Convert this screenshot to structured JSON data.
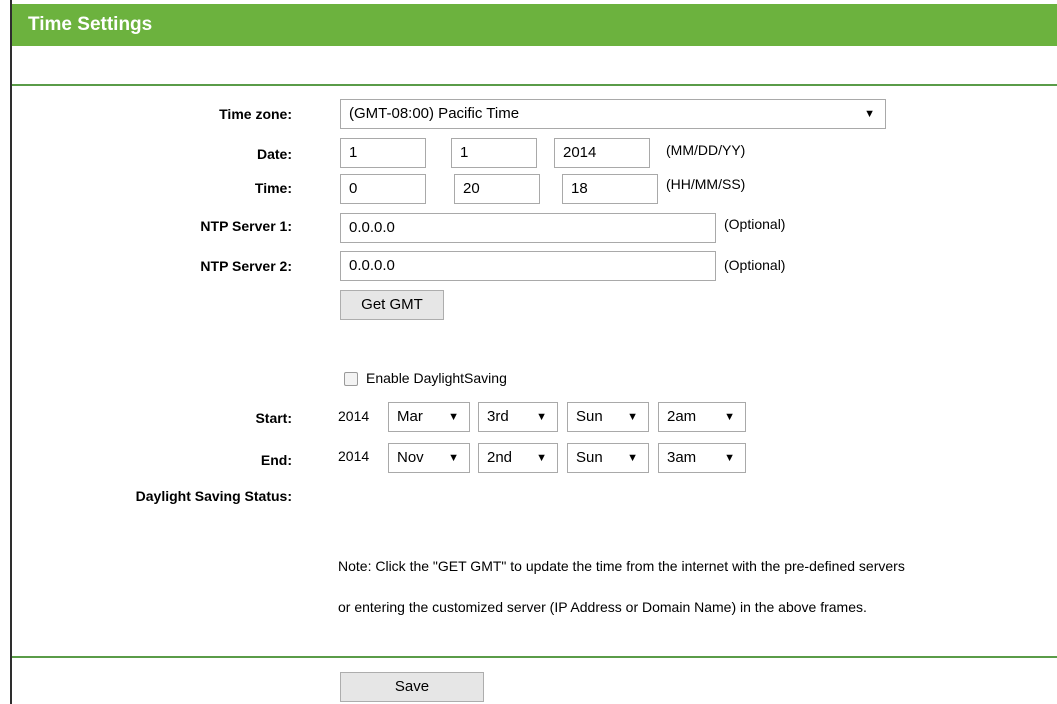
{
  "header": {
    "title": "Time Settings"
  },
  "form": {
    "time_zone": {
      "label": "Time zone:",
      "value": "(GMT-08:00) Pacific Time"
    },
    "date": {
      "label": "Date:",
      "month": "1",
      "day": "1",
      "year": "2014",
      "hint": "(MM/DD/YY)"
    },
    "time": {
      "label": "Time:",
      "hour": "0",
      "minute": "20",
      "second": "18",
      "hint": "(HH/MM/SS)"
    },
    "ntp1": {
      "label": "NTP Server 1:",
      "value": "0.0.0.0",
      "hint": "(Optional)"
    },
    "ntp2": {
      "label": "NTP Server 2:",
      "value": "0.0.0.0",
      "hint": "(Optional)"
    },
    "get_gmt_label": "Get GMT",
    "daylight": {
      "checkbox_label": "Enable DaylightSaving",
      "checked": false
    },
    "start": {
      "label": "Start:",
      "year": "2014",
      "month": "Mar",
      "week": "3rd",
      "day": "Sun",
      "hour": "2am"
    },
    "end": {
      "label": "End:",
      "year": "2014",
      "month": "Nov",
      "week": "2nd",
      "day": "Sun",
      "hour": "3am"
    },
    "status_label": "Daylight Saving Status:",
    "note_line1": "Note: Click the \"GET GMT\" to update the time from the internet with the pre-defined servers",
    "note_line2": "or entering the customized server (IP Address or Domain Name) in the above frames.",
    "save_label": "Save"
  },
  "colors": {
    "header_bg": "#6cb23e",
    "divider": "#5a9c48"
  }
}
